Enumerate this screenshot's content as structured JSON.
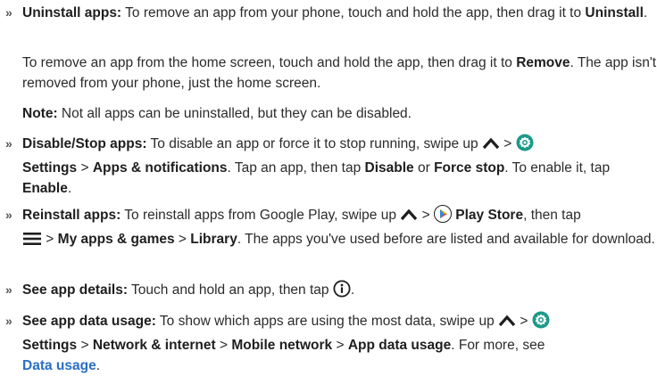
{
  "bullet": "»",
  "items": {
    "uninstall": {
      "title": "Uninstall apps:",
      "t1": " To remove an app from your phone, touch and hold the app, then drag it to ",
      "b1": "Uninstall",
      "t2": "."
    },
    "remove_home": {
      "t1": "To remove an app from the home screen, touch and hold the app, then drag it to ",
      "b1": "Remove",
      "t2": ". The app isn't removed from your phone, just the home screen."
    },
    "note": {
      "title": "Note:",
      "t1": " Not all apps can be uninstalled, but they can be disabled."
    },
    "disable": {
      "title": "Disable/Stop apps:",
      "t1": " To disable an app or force it to stop running, swipe up ",
      "t2": " > ",
      "b1": "Settings",
      "t3": " > ",
      "b2": "Apps & notifications",
      "t4": ". Tap an app, then tap ",
      "b3": "Disable",
      "t5": " or ",
      "b4": "Force stop",
      "t6": ". To enable it, tap ",
      "b5": "Enable",
      "t7": "."
    },
    "reinstall": {
      "title": "Reinstall apps:",
      "t1": " To reinstall apps from Google Play, swipe up ",
      "t2": " > ",
      "b1": "Play Store",
      "t3": ", then tap ",
      "t4": " > ",
      "b2": "My apps & games",
      "t5": " > ",
      "b3": "Library",
      "t6": ". The apps you've used before are listed and available for download."
    },
    "details": {
      "title": "See app details:",
      "t1": " Touch and hold an app, then tap ",
      "t2": "."
    },
    "data_usage": {
      "title": "See app data usage:",
      "t1": " To show which apps are using the most data, swipe up ",
      "t2": " > ",
      "b1": "Settings",
      "t3": " > ",
      "b2": "Network & internet",
      "t4": " > ",
      "b3": "Mobile network",
      "t5": " > ",
      "b4": "App data usage",
      "t6": ". For more, see ",
      "link": "Data usage",
      "t7": "."
    }
  },
  "icons": {
    "up": "chevron-up-icon",
    "settings": "settings-gear-icon",
    "play": "play-store-icon",
    "menu": "hamburger-menu-icon",
    "info": "info-icon"
  },
  "colors": {
    "text": "#2b2b2b",
    "link": "#2a6ec6",
    "settings_icon": "#1a9a8a",
    "play_icon": "#1fa463"
  }
}
